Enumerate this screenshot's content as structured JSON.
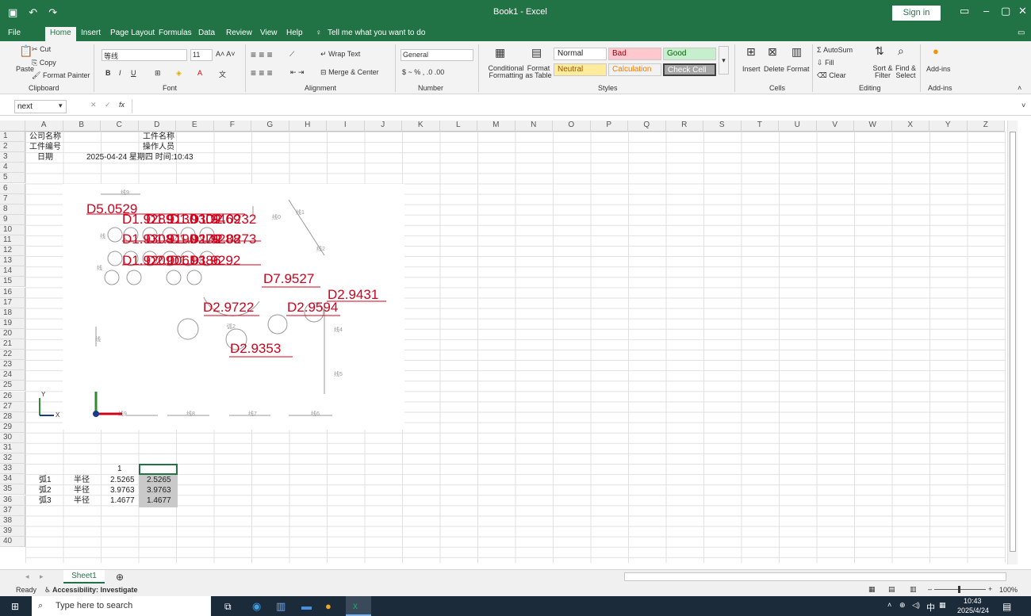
{
  "title": "Book1 - Excel",
  "signin": "Sign in",
  "tabs": [
    "File",
    "Home",
    "Insert",
    "Page Layout",
    "Formulas",
    "Data",
    "Review",
    "View",
    "Help",
    "Tell me what you want to do"
  ],
  "ribbon": {
    "clipboard": {
      "paste": "Paste",
      "cut": "Cut",
      "copy": "Copy",
      "painter": "Format Painter",
      "label": "Clipboard"
    },
    "font": {
      "name": "等线",
      "size": "11",
      "label": "Font"
    },
    "alignment": {
      "wrap": "Wrap Text",
      "merge": "Merge & Center",
      "label": "Alignment"
    },
    "number": {
      "format": "General",
      "label": "Number"
    },
    "styles": {
      "cond": "Conditional Formatting",
      "table": "Format as Table",
      "normal": "Normal",
      "bad": "Bad",
      "good": "Good",
      "neutral": "Neutral",
      "calc": "Calculation",
      "check": "Check Cell",
      "label": "Styles"
    },
    "cells": {
      "insert": "Insert",
      "delete": "Delete",
      "format": "Format",
      "label": "Cells"
    },
    "editing": {
      "autosum": "AutoSum",
      "fill": "Fill",
      "clear": "Clear",
      "sort": "Sort & Filter",
      "find": "Find & Select",
      "label": "Editing"
    },
    "addins": {
      "label": "Add-ins",
      "btn": "Add-ins"
    }
  },
  "namebox": "next",
  "fx": "fx",
  "columns": [
    "A",
    "B",
    "C",
    "D",
    "E",
    "F",
    "G",
    "H",
    "I",
    "J",
    "K",
    "L",
    "M",
    "N",
    "O",
    "P",
    "Q",
    "R",
    "S",
    "T",
    "U",
    "V",
    "W",
    "X",
    "Y",
    "Z"
  ],
  "rows": [
    "1",
    "2",
    "3",
    "4",
    "5",
    "6",
    "7",
    "8",
    "9",
    "10",
    "11",
    "12",
    "13",
    "14",
    "15",
    "16",
    "17",
    "18",
    "19",
    "20",
    "21",
    "22",
    "23",
    "24",
    "25",
    "26",
    "27",
    "28",
    "29",
    "30",
    "31",
    "32",
    "33",
    "34",
    "35",
    "36",
    "37",
    "38",
    "39",
    "40"
  ],
  "cells": {
    "a1": "公司名称",
    "d1": "工件名称",
    "a2": "工件编号",
    "d2": "操作人员",
    "a3": "日期",
    "b3": "2025-04-24 星期四 时间:10:43",
    "c32": "1",
    "a33": "弧1",
    "b33": "半径",
    "c33": "2.5265",
    "d33": "2.5265",
    "a34": "弧2",
    "b34": "半径",
    "c34": "3.9763",
    "d34": "3.9763",
    "a35": "弧3",
    "b35": "半径",
    "c35": "1.4677",
    "d35": "1.4677"
  },
  "dims": [
    "D5.0529",
    "D1.9289",
    "D1.9130",
    "D1.9309",
    "D1.9469",
    "D2.0232",
    "D1.9308",
    "D1.9190",
    "D1.9279",
    "D1.9288",
    "D2.0273",
    "D1.9209",
    "D2.0061",
    "D1.9386",
    "D1.9292",
    "D7.9527",
    "D2.9431",
    "D2.9722",
    "D2.9594",
    "D2.9353"
  ],
  "sheet": "Sheet1",
  "status": {
    "ready": "Ready",
    "access": "Accessibility: Investigate",
    "zoom": "100%"
  },
  "taskbar": {
    "search": "Type here to search",
    "time": "10:43",
    "date": "2025/4/24",
    "ime": "中"
  }
}
